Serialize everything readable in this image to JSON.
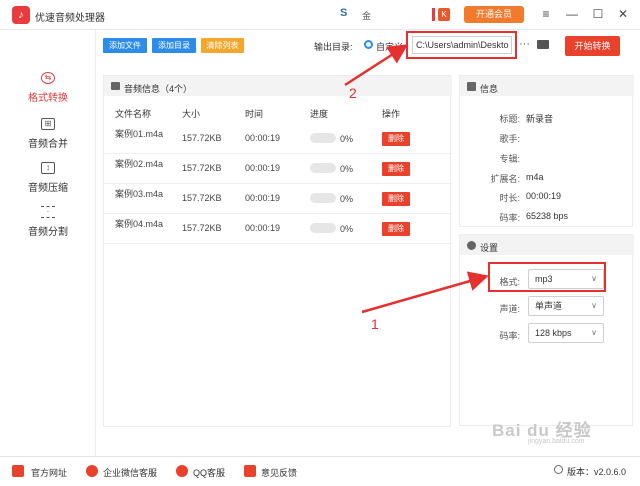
{
  "app": {
    "title": "优速音频处理器",
    "user_badge": "S",
    "user_name": "金",
    "crown": "K",
    "vip_label": "开通会员"
  },
  "window": {
    "menu": "≡",
    "minimize": "—",
    "maximize": "☐",
    "close": "✕"
  },
  "sidebar": {
    "items": [
      {
        "label": "格式转换",
        "icon": "convert-icon",
        "active": true
      },
      {
        "label": "音频合并",
        "icon": "merge-icon",
        "active": false
      },
      {
        "label": "音频压缩",
        "icon": "compress-icon",
        "active": false
      },
      {
        "label": "音频分割",
        "icon": "split-icon",
        "active": false
      }
    ]
  },
  "toolbar": {
    "add_file": "添加文件",
    "add_dir": "添加目录",
    "clear_list": "清除列表",
    "output_label": "输出目录:",
    "radio_label": "自定义",
    "path_value": "C:\\Users\\admin\\Deskto",
    "more": "···",
    "start": "开始转换"
  },
  "list": {
    "title": "音频信息（4个）",
    "columns": [
      "文件名称",
      "大小",
      "时间",
      "进度",
      "操作"
    ],
    "rows": [
      {
        "name": "案例01.m4a",
        "size": "157.72KB",
        "time": "00:00:19",
        "progress": "0%",
        "delete": "删除"
      },
      {
        "name": "案例02.m4a",
        "size": "157.72KB",
        "time": "00:00:19",
        "progress": "0%",
        "delete": "删除"
      },
      {
        "name": "案例03.m4a",
        "size": "157.72KB",
        "time": "00:00:19",
        "progress": "0%",
        "delete": "删除"
      },
      {
        "name": "案例04.m4a",
        "size": "157.72KB",
        "time": "00:00:19",
        "progress": "0%",
        "delete": "删除"
      }
    ]
  },
  "info": {
    "title": "信息",
    "fields": [
      {
        "key": "标题:",
        "value": "新录音"
      },
      {
        "key": "歌手:",
        "value": ""
      },
      {
        "key": "专辑:",
        "value": ""
      },
      {
        "key": "扩展名:",
        "value": "m4a"
      },
      {
        "key": "时长:",
        "value": "00:00:19"
      },
      {
        "key": "码率:",
        "value": "65238 bps"
      }
    ]
  },
  "settings": {
    "title": "设置",
    "format_label": "格式:",
    "format_value": "mp3",
    "channel_label": "声道:",
    "channel_value": "单声道",
    "bitrate_label": "码率:",
    "bitrate_value": "128 kbps"
  },
  "annotations": {
    "one": "1",
    "two": "2"
  },
  "footer": {
    "site": "官方网址",
    "wechat": "企业微信客服",
    "qq": "QQ客服",
    "feedback": "意见反馈",
    "version": "版本：v2.0.6.0"
  },
  "watermark": {
    "text": "Bai du 经验",
    "url": "jingyan.baidu.com"
  },
  "colors": {
    "accent_red": "#e8422c",
    "accent_blue": "#2c8ce8",
    "accent_orange": "#f3a72c",
    "annotation_red": "#e53030"
  }
}
